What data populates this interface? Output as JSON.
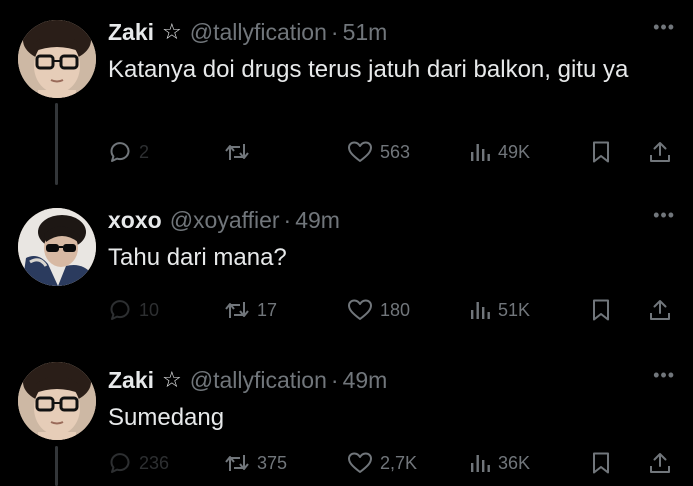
{
  "colors": {
    "background": "#000000",
    "text_primary": "#e7e9ea",
    "text_secondary": "#71767b",
    "thread_line": "#333639"
  },
  "tweets": [
    {
      "name": "Zaki",
      "verified_star": "☆",
      "handle": "@tallyfication",
      "separator": "·",
      "time": "51m",
      "text": "Katanya doi drugs terus jatuh dari balkon, gitu ya",
      "replies": "2",
      "retweets": "",
      "likes": "563",
      "views": "49K"
    },
    {
      "name": "xoxo",
      "handle": "@xoyaffier",
      "separator": "·",
      "time": "49m",
      "text": "Tahu dari mana?",
      "replies": "10",
      "retweets": "17",
      "likes": "180",
      "views": "51K"
    },
    {
      "name": "Zaki",
      "verified_star": "☆",
      "handle": "@tallyfication",
      "separator": "·",
      "time": "49m",
      "text": "Sumedang",
      "replies": "236",
      "retweets": "375",
      "likes": "2,7K",
      "views": "36K"
    }
  ],
  "icons": {
    "reply": "reply-icon",
    "retweet": "retweet-icon",
    "like": "heart-icon",
    "views": "views-icon",
    "bookmark": "bookmark-icon",
    "share": "share-icon",
    "more": "more-options-icon"
  },
  "more_glyph": "•••"
}
